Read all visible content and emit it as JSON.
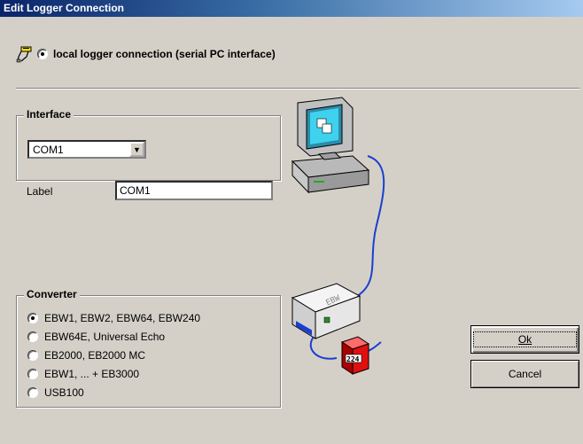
{
  "window": {
    "title": "Edit Logger Connection"
  },
  "connection": {
    "label": "local logger connection (serial PC interface)",
    "selected": true,
    "icon": "serial-cable-icon"
  },
  "interface": {
    "group_title": "Interface",
    "port_value": "COM1",
    "label_caption": "Label",
    "label_value": "COM1"
  },
  "converter": {
    "group_title": "Converter",
    "options": [
      {
        "label": "EBW1, EBW2, EBW64, EBW240",
        "selected": true
      },
      {
        "label": "EBW64E, Universal Echo",
        "selected": false
      },
      {
        "label": "EB2000, EB2000 MC",
        "selected": false
      },
      {
        "label": "EBW1, ... + EB3000",
        "selected": false
      },
      {
        "label": "USB100",
        "selected": false
      }
    ]
  },
  "buttons": {
    "ok": "Ok",
    "cancel": "Cancel"
  },
  "illustration": {
    "device_text": "EBW",
    "logger_text": "224",
    "computer_icon": "computer-icon",
    "converter_icon": "converter-box-icon",
    "logger_icon": "logger-device-icon"
  }
}
